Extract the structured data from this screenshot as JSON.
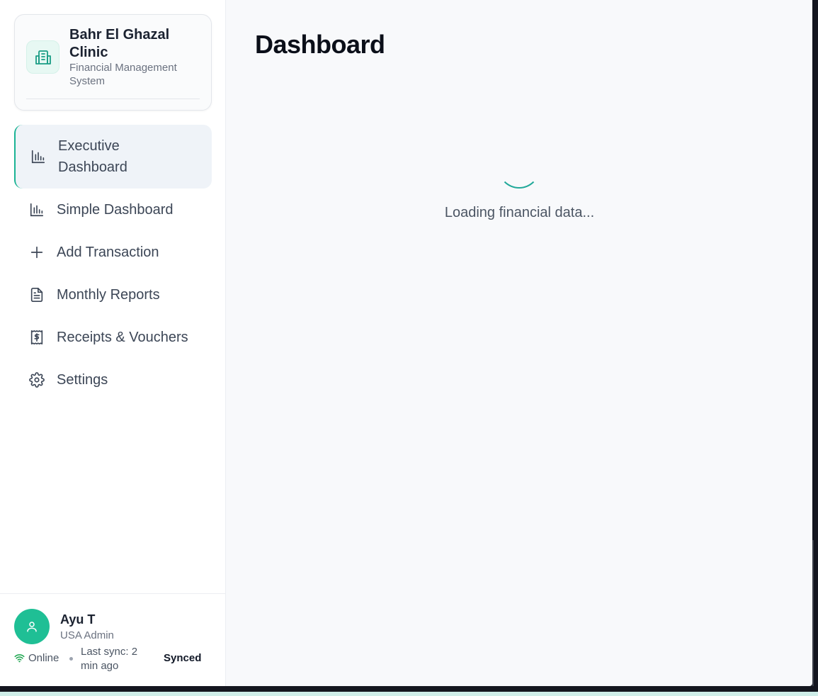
{
  "brand": {
    "name": "Bahr El Ghazal Clinic",
    "subtitle": "Financial Management System",
    "icon": "building-icon"
  },
  "nav": {
    "items": [
      {
        "label": "Executive Dashboard",
        "icon": "bar-chart-icon",
        "active": true
      },
      {
        "label": "Simple Dashboard",
        "icon": "bar-chart-icon",
        "active": false
      },
      {
        "label": "Add Transaction",
        "icon": "plus-icon",
        "active": false
      },
      {
        "label": "Monthly Reports",
        "icon": "file-text-icon",
        "active": false
      },
      {
        "label": "Receipts & Vouchers",
        "icon": "receipt-icon",
        "active": false
      },
      {
        "label": "Settings",
        "icon": "gear-icon",
        "active": false
      }
    ]
  },
  "user": {
    "name": "Ayu T",
    "role": "USA Admin"
  },
  "status": {
    "connection": "Online",
    "last_sync": "Last sync: 2 min ago",
    "sync_state": "Synced"
  },
  "main": {
    "title": "Dashboard",
    "loading_text": "Loading financial data..."
  },
  "colors": {
    "accent": "#1ab394",
    "avatar": "#1fbf95",
    "spinner": "#22a99a"
  }
}
